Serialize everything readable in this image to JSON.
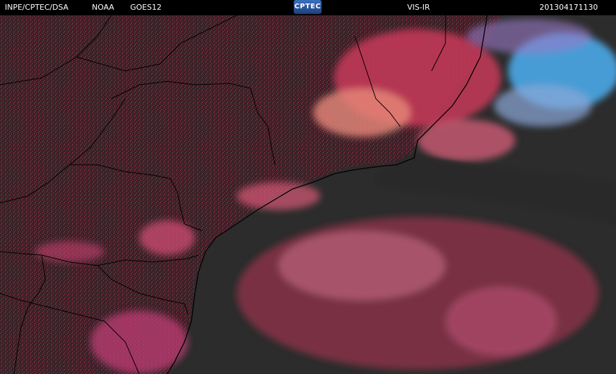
{
  "header": {
    "source": "INPE/CPTEC/DSA",
    "agency": "NOAA",
    "satellite": "GOES12",
    "logo_text": "CPTEC",
    "channel": "VIS-IR",
    "timestamp": "201304171130"
  },
  "colors": {
    "background": "#2a2a2a",
    "cloud_low": "#c8385a",
    "cloud_high": "#e87a8a",
    "cold_top": "#4aa8e8",
    "borders": "#000000"
  }
}
